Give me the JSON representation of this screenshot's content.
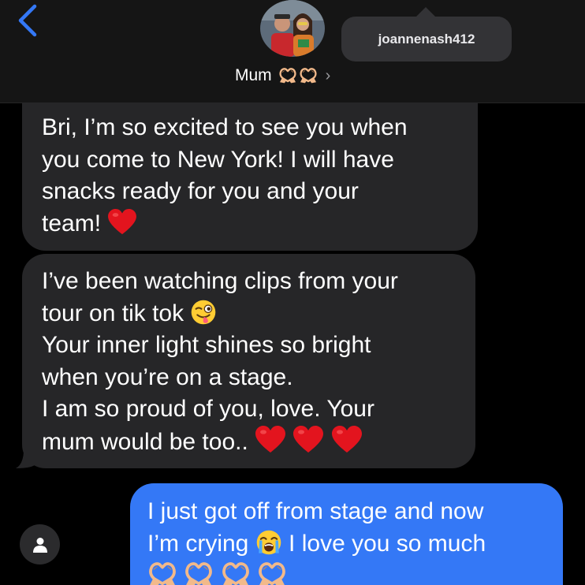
{
  "header": {
    "contact_name": "Mum",
    "username_tooltip": "joannenash412",
    "chevron": "›"
  },
  "messages": [
    {
      "direction": "incoming",
      "lines": [
        "Bri, I’m so excited to see you when",
        "you come to New York! I will have",
        "snacks ready for you and your",
        "team!"
      ],
      "emoji": [
        "red-heart"
      ]
    },
    {
      "direction": "incoming",
      "lines": [
        "I’ve been watching clips from your",
        "tour on tik tok",
        "Your inner light shines so bright",
        "when you’re on a stage.",
        "I am so proud of you, love. Your",
        "mum would be too.."
      ],
      "emoji": [
        "winking-face-with-tongue",
        "red-heart",
        "red-heart",
        "red-heart"
      ]
    },
    {
      "direction": "outgoing",
      "lines": [
        "I just got off from stage and now",
        "I’m crying",
        "I love you so much"
      ],
      "emoji": [
        "loudly-crying-face",
        "heart-hands",
        "heart-hands",
        "heart-hands",
        "heart-hands"
      ]
    }
  ],
  "colors": {
    "background": "#000000",
    "header": "#151515",
    "incoming_bubble": "#262628",
    "outgoing_bubble": "#3478f6",
    "accent": "#3478f6"
  }
}
